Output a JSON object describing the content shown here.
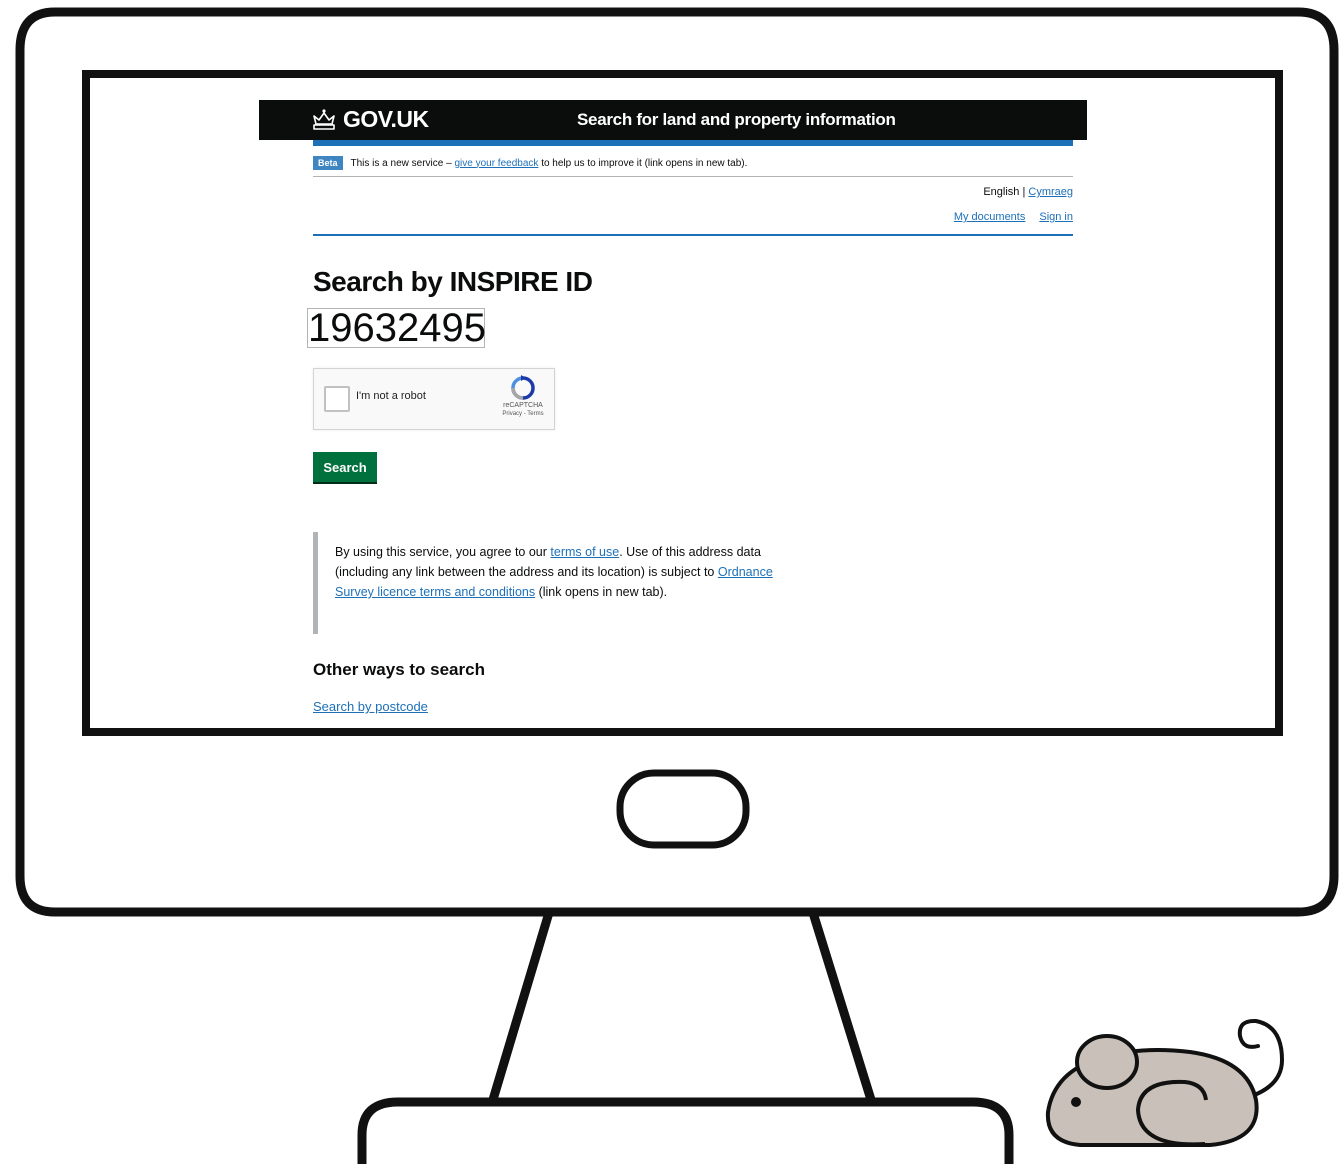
{
  "header": {
    "logo_text": "GOV.UK",
    "service_name": "Search for land and property information"
  },
  "phase_banner": {
    "tag": "Beta",
    "text_before": "This is a new service –",
    "feedback_link": "give your feedback",
    "text_after": "to help us to improve it (link opens in new tab)."
  },
  "language": {
    "current": "English",
    "separator": "|",
    "other": "Cymraeg"
  },
  "account_nav": {
    "my_documents": "My documents",
    "sign_in": "Sign in"
  },
  "main": {
    "title": "Search by INSPIRE ID",
    "inspire_id_value": "19632495"
  },
  "recaptcha": {
    "label": "I'm not a robot",
    "brand": "reCAPTCHA",
    "terms": "Privacy - Terms"
  },
  "search_button": "Search",
  "terms": {
    "text_1": "By using this service, you agree to our",
    "terms_link": "terms of use",
    "text_2": ". Use of this address data (including any link between the address and its location) is subject to",
    "os_link": "Ordnance Survey licence terms and conditions",
    "text_3": "(link opens in new tab)."
  },
  "other_ways": {
    "heading": "Other ways to search",
    "postcode_link": "Search by postcode"
  },
  "colors": {
    "header_bg": "#0b0c0c",
    "accent_blue": "#1d70b8",
    "button_green": "#00703c",
    "mouse_fill": "#c9c1b9"
  }
}
